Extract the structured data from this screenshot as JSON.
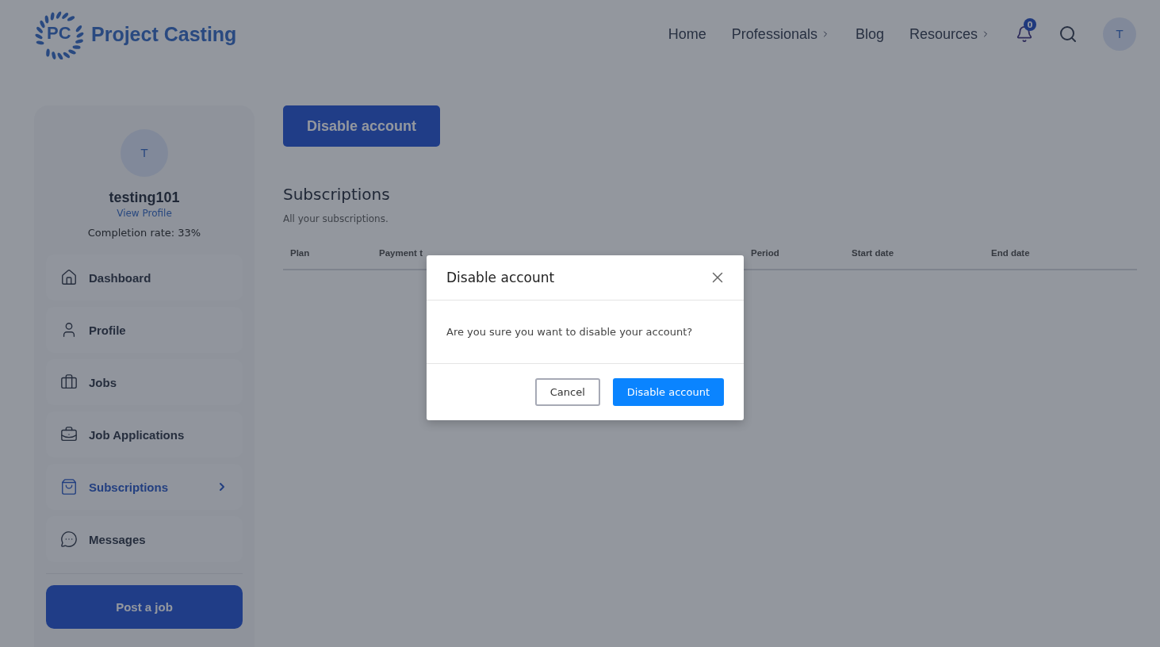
{
  "brand": {
    "mark": "PC",
    "name": "Project Casting"
  },
  "nav": [
    {
      "label": "Home",
      "has_submenu": false
    },
    {
      "label": "Professionals",
      "has_submenu": true
    },
    {
      "label": "Blog",
      "has_submenu": false
    },
    {
      "label": "Resources",
      "has_submenu": true
    }
  ],
  "notifications": {
    "count": "0"
  },
  "user_avatar": "T",
  "profile": {
    "avatar": "T",
    "username": "testing101",
    "view_link": "View Profile",
    "completion": "Completion rate: 33%"
  },
  "sidebar": {
    "items": [
      {
        "label": "Dashboard",
        "kind": "home",
        "selected": false
      },
      {
        "label": "Profile",
        "kind": "user",
        "selected": false
      },
      {
        "label": "Jobs",
        "kind": "briefcase",
        "selected": false
      },
      {
        "label": "Job Applications",
        "kind": "check-briefcase",
        "selected": false
      },
      {
        "label": "Subscriptions",
        "kind": "bag",
        "selected": true
      },
      {
        "label": "Messages",
        "kind": "chat",
        "selected": false
      }
    ],
    "post_button": "Post a job"
  },
  "main": {
    "disable_button": "Disable account",
    "title": "Subscriptions",
    "subtitle": "All your subscriptions.",
    "table": {
      "columns": [
        "Plan",
        "Payment t",
        "Period",
        "Start date",
        "End date"
      ]
    }
  },
  "modal": {
    "title": "Disable account",
    "message": "Are you sure you want to disable your account?",
    "buttons": [
      {
        "label": "Cancel",
        "kind": "secondary"
      },
      {
        "label": "Disable account",
        "kind": "primary"
      }
    ]
  }
}
